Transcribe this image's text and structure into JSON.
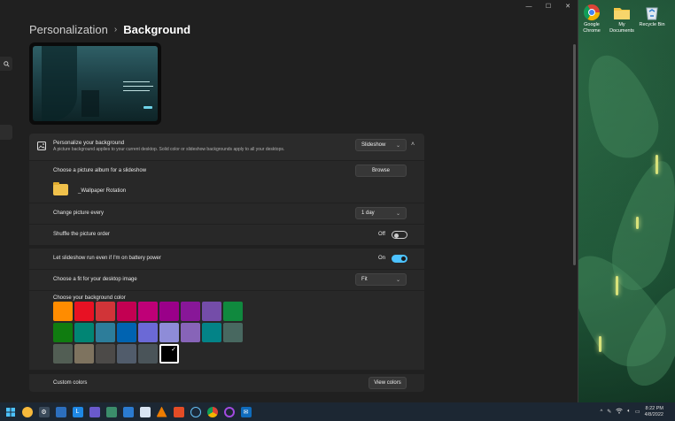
{
  "desktop": {
    "icons": [
      {
        "label": "Google Chrome",
        "icon": "chrome-icon"
      },
      {
        "label": "My Documents",
        "icon": "folder-icon"
      },
      {
        "label": "Recycle Bin",
        "icon": "recycle-bin-icon"
      }
    ]
  },
  "window": {
    "breadcrumb_parent": "Personalization",
    "breadcrumb_sep": "›",
    "breadcrumb_current": "Background",
    "minimize": "—",
    "maximize": "☐",
    "close": "✕"
  },
  "personalize": {
    "title": "Personalize your background",
    "subtitle": "A picture background applies to your current desktop. Solid color or slideshow backgrounds apply to all your desktops.",
    "dropdown_value": "Slideshow",
    "collapse": "˄"
  },
  "album": {
    "label": "Choose a picture album for a slideshow",
    "browse": "Browse",
    "folder_name": "_Wallpaper Rotation"
  },
  "change_every": {
    "label": "Change picture every",
    "value": "1 day"
  },
  "shuffle": {
    "label": "Shuffle the picture order",
    "state": "Off",
    "on": false
  },
  "battery": {
    "label": "Let slideshow run even if I'm on battery power",
    "state": "On",
    "on": true
  },
  "fit": {
    "label": "Choose a fit for your desktop image",
    "value": "Fit"
  },
  "colors": {
    "label": "Choose your background color",
    "rows": [
      [
        "#ff8c00",
        "#e81123",
        "#d13438",
        "#c30052",
        "#bf0077",
        "#9a0089",
        "#881798",
        "#744da9",
        "#10893e"
      ],
      [
        "#107c10",
        "#018574",
        "#2d7d9a",
        "#0063b1",
        "#6b69d6",
        "#8e8cd8",
        "#8764b8",
        "#038387",
        "#486860"
      ],
      [
        "#525e54",
        "#7e735f",
        "#4c4a48",
        "#515c6b",
        "#4a5459",
        "#000000"
      ]
    ],
    "selected": "#000000",
    "custom_label": "Custom colors",
    "view_colors": "View colors"
  },
  "taskbar": {
    "icons": [
      "start-icon",
      "weather-icon",
      "settings-icon",
      "store-icon",
      "l-app-icon",
      "photos-icon",
      "network-icon",
      "media-icon",
      "calendar-icon",
      "vlc-icon",
      "paint-icon",
      "steam-icon",
      "chrome-icon",
      "circle-app-icon",
      "mail-icon"
    ],
    "tray_chevron": "^",
    "time": "8:22 PM",
    "date": "4/8/2022"
  }
}
